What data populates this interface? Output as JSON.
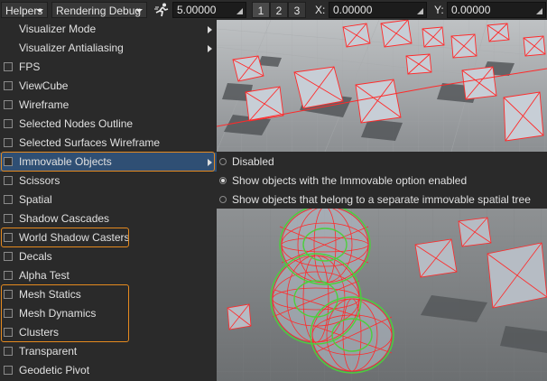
{
  "toolbar": {
    "helpers_label": "Helpers",
    "rendering_debug_label": "Rendering Debug",
    "camera_speed_value": "5.00000",
    "buttons": [
      "1",
      "2",
      "3"
    ],
    "x_label": "X:",
    "x_value": "0.00000",
    "y_label": "Y:",
    "y_value": "0.00000"
  },
  "menu": {
    "items": [
      {
        "label": "Visualizer Mode"
      },
      {
        "label": "Visualizer Antialiasing"
      },
      {
        "label": "FPS"
      },
      {
        "label": "ViewCube"
      },
      {
        "label": "Wireframe"
      },
      {
        "label": "Selected Nodes Outline"
      },
      {
        "label": "Selected Surfaces Wireframe"
      },
      {
        "label": "Immovable Objects"
      },
      {
        "label": "Scissors"
      },
      {
        "label": "Spatial"
      },
      {
        "label": "Shadow Cascades"
      },
      {
        "label": "World Shadow Casters"
      },
      {
        "label": "Decals"
      },
      {
        "label": "Alpha Test"
      },
      {
        "label": "Mesh Statics"
      },
      {
        "label": "Mesh Dynamics"
      },
      {
        "label": "Clusters"
      },
      {
        "label": "Transparent"
      },
      {
        "label": "Geodetic Pivot"
      }
    ]
  },
  "submenu": {
    "options": [
      {
        "label": "Disabled"
      },
      {
        "label": "Show objects with the Immovable option enabled"
      },
      {
        "label": "Show objects that belong to a separate immovable spatial tree"
      }
    ],
    "selected_index": 1
  },
  "colors": {
    "highlight": "#2f4f74",
    "callout": "#e58a1f",
    "wire_red": "#ff2a2a",
    "wire_green": "#4ccf3c"
  }
}
